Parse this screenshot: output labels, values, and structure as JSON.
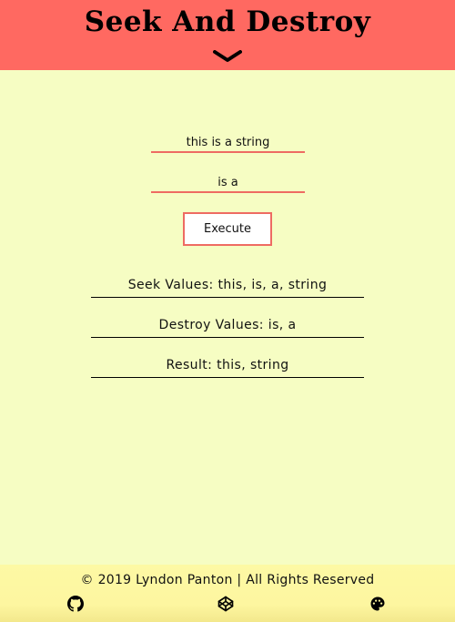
{
  "header": {
    "title": "Seek And Destroy",
    "toggle_icon": "chevron-down-icon",
    "background": "#ff6961"
  },
  "form": {
    "seek_input_value": "this is a string",
    "destroy_input_value": "is a",
    "execute_label": "Execute",
    "accent": "#ee6b62"
  },
  "outputs": {
    "seek_values": "Seek Values: this, is, a, string",
    "destroy_values": "Destroy Values: is, a",
    "result": "Result: this, string"
  },
  "footer": {
    "copyright": "© 2019 Lyndon Panton | All Rights Reserved",
    "icons": [
      "github-icon",
      "codepen-icon",
      "palette-icon"
    ]
  },
  "colors": {
    "page_background": "#f6fdc3",
    "footer_background": "#fdf6a0"
  }
}
